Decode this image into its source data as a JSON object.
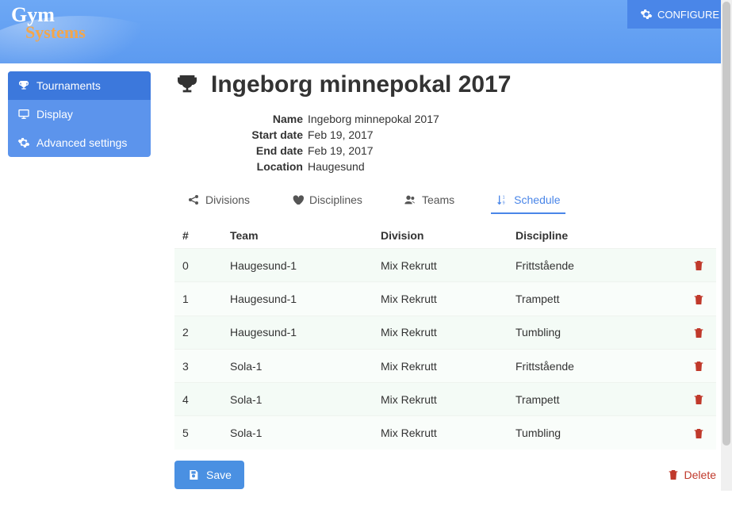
{
  "app": {
    "logo_line1": "Gym",
    "logo_line2": "Systems"
  },
  "topbar": {
    "configure": "CONFIGURE"
  },
  "sidebar": {
    "items": [
      {
        "label": "Tournaments",
        "active": true
      },
      {
        "label": "Display",
        "active": false
      },
      {
        "label": "Advanced settings",
        "active": false
      }
    ]
  },
  "page": {
    "title": "Ingeborg minnepokal 2017"
  },
  "meta": {
    "labels": {
      "name": "Name",
      "start": "Start date",
      "end": "End date",
      "location": "Location"
    },
    "values": {
      "name": "Ingeborg minnepokal 2017",
      "start": "Feb 19, 2017",
      "end": "Feb 19, 2017",
      "location": "Haugesund"
    }
  },
  "tabs": [
    {
      "label": "Divisions",
      "active": false
    },
    {
      "label": "Disciplines",
      "active": false
    },
    {
      "label": "Teams",
      "active": false
    },
    {
      "label": "Schedule",
      "active": true
    }
  ],
  "table": {
    "headers": {
      "num": "#",
      "team": "Team",
      "division": "Division",
      "discipline": "Discipline"
    },
    "rows": [
      {
        "num": "0",
        "team": "Haugesund-1",
        "division": "Mix Rekrutt",
        "discipline": "Frittstående"
      },
      {
        "num": "1",
        "team": "Haugesund-1",
        "division": "Mix Rekrutt",
        "discipline": "Trampett"
      },
      {
        "num": "2",
        "team": "Haugesund-1",
        "division": "Mix Rekrutt",
        "discipline": "Tumbling"
      },
      {
        "num": "3",
        "team": "Sola-1",
        "division": "Mix Rekrutt",
        "discipline": "Frittstående"
      },
      {
        "num": "4",
        "team": "Sola-1",
        "division": "Mix Rekrutt",
        "discipline": "Trampett"
      },
      {
        "num": "5",
        "team": "Sola-1",
        "division": "Mix Rekrutt",
        "discipline": "Tumbling"
      }
    ]
  },
  "actions": {
    "save": "Save",
    "delete": "Delete"
  }
}
